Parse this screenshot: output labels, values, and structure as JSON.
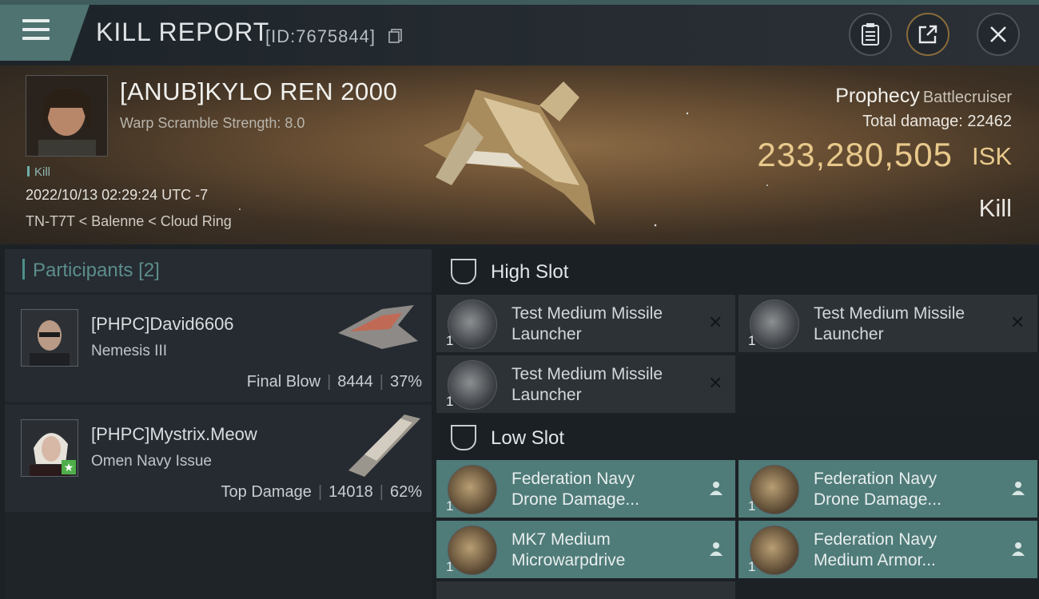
{
  "header": {
    "title": "KILL REPORT",
    "report_id": "[ID:7675844]"
  },
  "victim": {
    "name": "[ANUB]KYLO REN 2000",
    "warp_scramble": "Warp Scramble Strength: 8.0",
    "tag": "Kill",
    "datetime": "2022/10/13 02:29:24 UTC -7",
    "location": "TN-T7T < Balenne < Cloud Ring",
    "ship_name": "Prophecy",
    "ship_class": "Battlecruiser",
    "total_damage_label": "Total damage:",
    "total_damage": "22462",
    "isk_value": "233,280,505",
    "isk_unit": "ISK",
    "result": "Kill"
  },
  "participants": {
    "title": "Participants",
    "count": "[2]",
    "items": [
      {
        "name": "[PHPC]David6606",
        "ship": "Nemesis III",
        "role": "Final Blow",
        "damage": "8444",
        "percent": "37%"
      },
      {
        "name": "[PHPC]Mystrix.Meow",
        "ship": "Omen Navy Issue",
        "role": "Top Damage",
        "damage": "14018",
        "percent": "62%"
      }
    ]
  },
  "high_slot": {
    "title": "High Slot",
    "items": [
      {
        "qty": "1",
        "line1": "Test Medium Missile",
        "line2": "Launcher",
        "status": "destroyed"
      },
      {
        "qty": "1",
        "line1": "Test Medium Missile",
        "line2": "Launcher",
        "status": "destroyed"
      },
      {
        "qty": "1",
        "line1": "Test Medium Missile",
        "line2": "Launcher",
        "status": "destroyed"
      }
    ]
  },
  "low_slot": {
    "title": "Low Slot",
    "items": [
      {
        "qty": "1",
        "line1": "Federation Navy",
        "line2": "Drone Damage...",
        "status": "dropped"
      },
      {
        "qty": "1",
        "line1": "Federation Navy",
        "line2": "Drone Damage...",
        "status": "dropped"
      },
      {
        "qty": "1",
        "line1": "MK7 Medium",
        "line2": "Microwarpdrive",
        "status": "dropped"
      },
      {
        "qty": "1",
        "line1": "Federation Navy",
        "line2": "Medium Armor...",
        "status": "dropped"
      }
    ]
  },
  "colors": {
    "accent_teal": "#4f7b78",
    "isk_gold": "#e8c98c"
  }
}
